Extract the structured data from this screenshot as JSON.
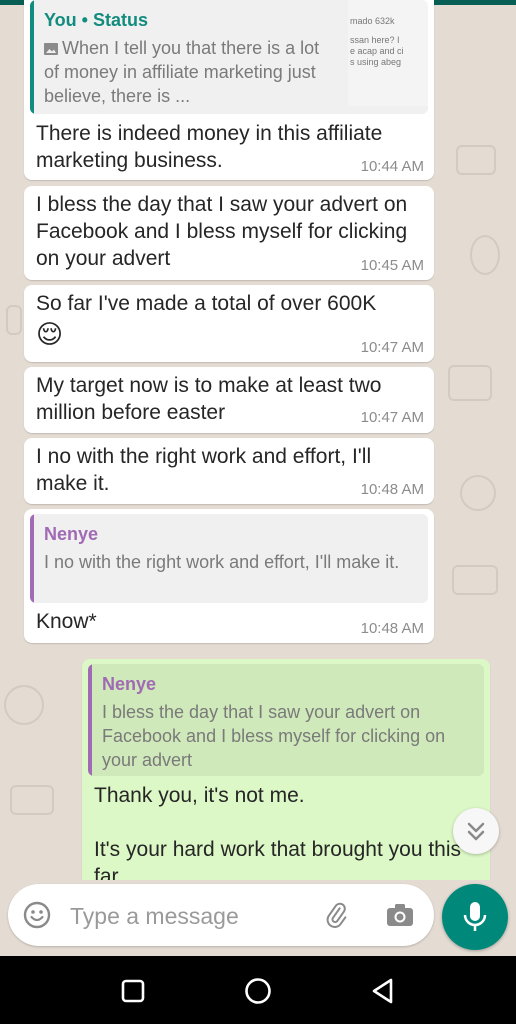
{
  "colors": {
    "header": "#075e54",
    "incoming_bubble": "#ffffff",
    "outgoing_bubble": "#dcf8c6",
    "you_author": "#128c7e",
    "nenye_author": "#a06ab4",
    "mic_button": "#00897b"
  },
  "messages": [
    {
      "quote": {
        "author": "You • Status",
        "icon": "image-icon",
        "text": "When I tell you that there is a lot of money in affiliate marketing just believe, there is ...",
        "thumbnail_lines": [
          "mado 632k",
          "",
          "",
          "ssan here? I",
          "e acap and ci",
          "s using abeg"
        ]
      },
      "text": "There is indeed money in this affiliate marketing business.",
      "time": "10:44 AM"
    },
    {
      "text": "I bless the day that I saw your advert on Facebook and I bless myself for clicking on your advert",
      "time": "10:45 AM"
    },
    {
      "text": "So far I've made a total of over 600K",
      "emoji": "😌",
      "time": "10:47 AM"
    },
    {
      "text": "My target now is to make at least two million before easter",
      "time": "10:47 AM"
    },
    {
      "text": "I no with the right work and effort, I'll make it.",
      "time": "10:48 AM"
    },
    {
      "quote": {
        "author": "Nenye",
        "text": "I no with the right work and effort, I'll make it."
      },
      "text": "Know*",
      "time": "10:48 AM"
    },
    {
      "quote": {
        "author": "Nenye",
        "text": "I bless the day that I saw your advert on Facebook and I bless myself for clicking on your advert"
      },
      "text_line1": "Thank you, it's not me.",
      "text_line2": "It's your hard work that brought you this far"
    }
  ],
  "input": {
    "placeholder": "Type a message",
    "emoji_icon": "emoji-icon",
    "attach_icon": "paperclip-icon",
    "camera_icon": "camera-icon",
    "mic_icon": "mic-icon"
  },
  "navbar": {
    "recents_icon": "recents-square-icon",
    "home_icon": "home-circle-icon",
    "back_icon": "back-triangle-icon"
  }
}
